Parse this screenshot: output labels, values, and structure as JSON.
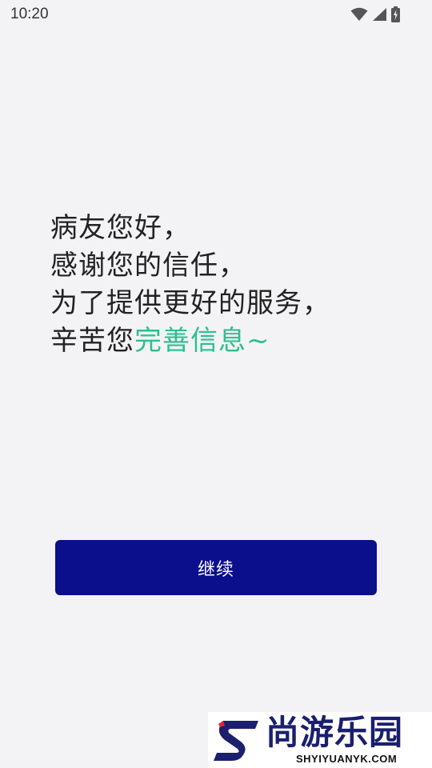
{
  "status_bar": {
    "time": "10:20",
    "icons": [
      "wifi-icon",
      "cell-signal-icon",
      "battery-charging-icon"
    ]
  },
  "greeting": {
    "line1": "病友您好，",
    "line2": "感谢您的信任，",
    "line3": "为了提供更好的服务，",
    "line4_prefix": "辛苦您",
    "line4_highlight": "完善信息~"
  },
  "actions": {
    "continue_label": "继续"
  },
  "watermark": {
    "title": "尚游乐园",
    "subtitle": "SHYIYUANYK.COM"
  },
  "colors": {
    "background": "#f3f3f6",
    "primary_button": "#0b0f8c",
    "highlight_text": "#2dc08c",
    "body_text": "#222222"
  }
}
